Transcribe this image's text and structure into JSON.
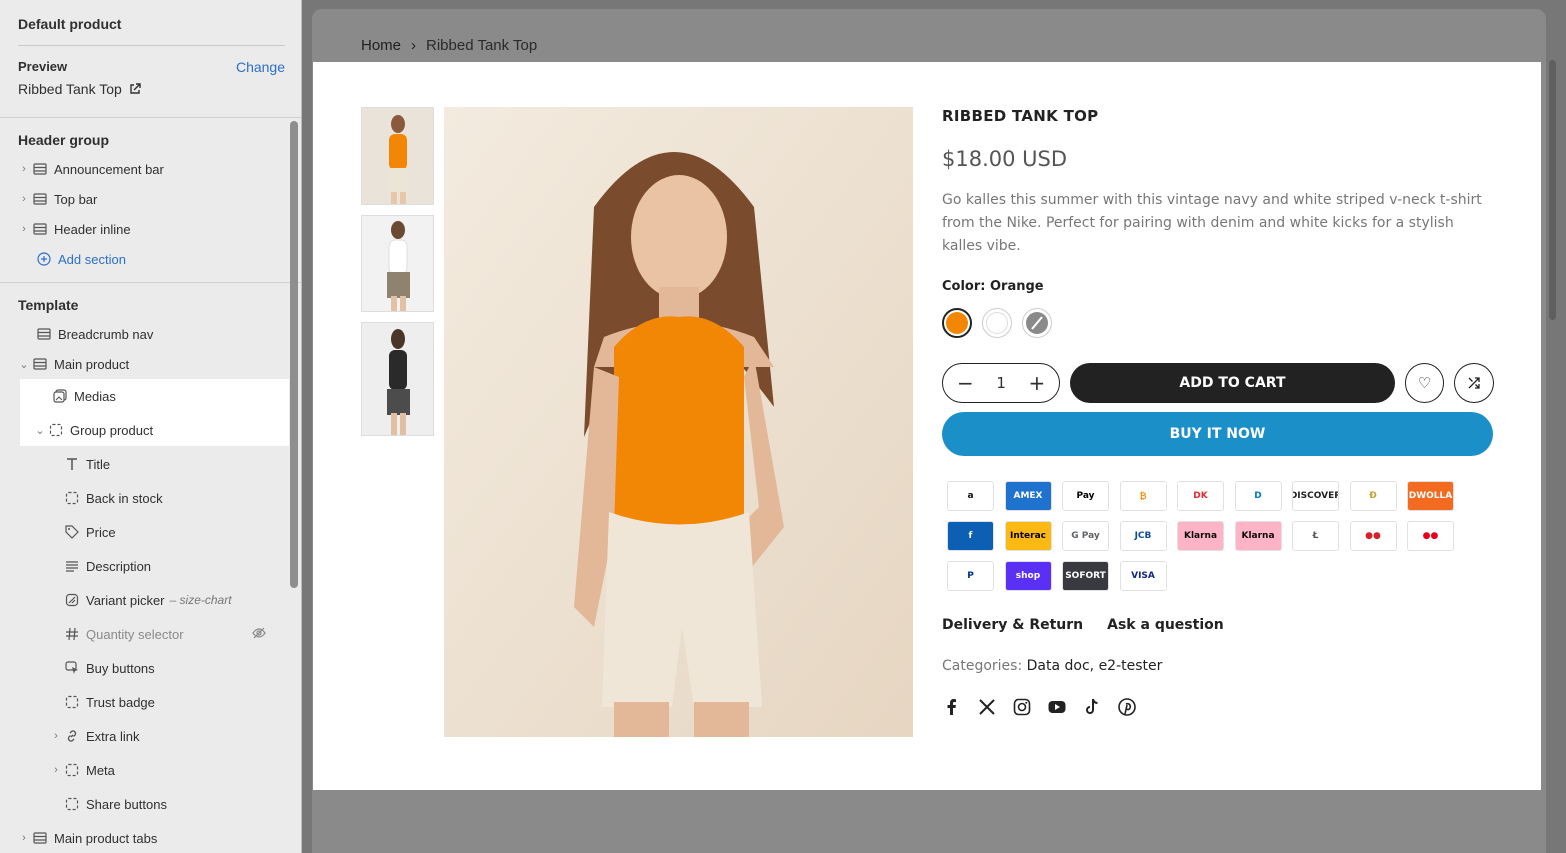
{
  "sidebar": {
    "title": "Default product",
    "preview_label": "Preview",
    "change_label": "Change",
    "preview_product": "Ribbed Tank Top",
    "header_group": {
      "label": "Header group",
      "items": [
        "Announcement bar",
        "Top bar",
        "Header inline"
      ],
      "add_section": "Add section"
    },
    "template": {
      "label": "Template",
      "breadcrumb": "Breadcrumb nav",
      "main_product": "Main product",
      "medias": "Medias",
      "group_product": "Group product",
      "blocks": [
        {
          "label": "Title",
          "icon": "text-icon"
        },
        {
          "label": "Back in stock",
          "icon": "block-icon"
        },
        {
          "label": "Price",
          "icon": "price-tag-icon"
        },
        {
          "label": "Description",
          "icon": "paragraph-icon"
        },
        {
          "label": "Variant picker",
          "hint": "– size-chart",
          "icon": "variant-icon"
        },
        {
          "label": "Quantity selector",
          "icon": "hash-icon",
          "hidden": true
        },
        {
          "label": "Buy buttons",
          "icon": "cursor-icon"
        },
        {
          "label": "Trust badge",
          "icon": "block-icon"
        },
        {
          "label": "Extra link",
          "icon": "link-icon",
          "expandable": true
        },
        {
          "label": "Meta",
          "icon": "block-icon",
          "expandable": true
        },
        {
          "label": "Share buttons",
          "icon": "block-icon"
        }
      ],
      "main_product_tabs": "Main product tabs"
    }
  },
  "breadcrumb": {
    "home": "Home",
    "separator": "›",
    "current": "Ribbed Tank Top"
  },
  "product": {
    "title": "RIBBED TANK TOP",
    "price": "$18.00 USD",
    "description": "Go kalles this summer with this vintage navy and white striped v-neck t-shirt from the Nike. Perfect for pairing with denim and white kicks for a stylish kalles vibe.",
    "color_label": "Color: Orange",
    "swatches": [
      {
        "name": "orange",
        "color": "#f28705",
        "selected": true
      },
      {
        "name": "white",
        "color": "#ffffff",
        "selected": false
      },
      {
        "name": "grey",
        "color": "#8a8a8a",
        "selected": false
      }
    ],
    "quantity": "1",
    "add_to_cart": "ADD TO CART",
    "buy_now": "BUY IT NOW",
    "payments": [
      {
        "label": "a",
        "bg": "#ffffff",
        "fg": "#111111"
      },
      {
        "label": "AMEX",
        "bg": "#1f72cd",
        "fg": "#ffffff"
      },
      {
        "label": " Pay",
        "bg": "#ffffff",
        "fg": "#000000"
      },
      {
        "label": "₿",
        "bg": "#ffffff",
        "fg": "#f7931a"
      },
      {
        "label": "DK",
        "bg": "#ffffff",
        "fg": "#e32b32"
      },
      {
        "label": "D",
        "bg": "#ffffff",
        "fg": "#0079be"
      },
      {
        "label": "DISCOVER",
        "bg": "#ffffff",
        "fg": "#222222"
      },
      {
        "label": "Ð",
        "bg": "#ffffff",
        "fg": "#c2a633"
      },
      {
        "label": "DWOLLA",
        "bg": "#f26b21",
        "fg": "#ffffff"
      },
      {
        "label": "f",
        "bg": "#0c5fb3",
        "fg": "#ffffff"
      },
      {
        "label": "Interac",
        "bg": "#fdb913",
        "fg": "#000000"
      },
      {
        "label": "G Pay",
        "bg": "#ffffff",
        "fg": "#5f6368"
      },
      {
        "label": "JCB",
        "bg": "#ffffff",
        "fg": "#0e4c96"
      },
      {
        "label": "Klarna",
        "bg": "#ffb3c7",
        "fg": "#0a0b09"
      },
      {
        "label": "Klarna",
        "bg": "#ffb3c7",
        "fg": "#0a0b09"
      },
      {
        "label": "Ł",
        "bg": "#ffffff",
        "fg": "#555555"
      },
      {
        "label": "●●",
        "bg": "#ffffff",
        "fg": "#d82028"
      },
      {
        "label": "●●",
        "bg": "#ffffff",
        "fg": "#eb001b"
      },
      {
        "label": "P",
        "bg": "#ffffff",
        "fg": "#003087"
      },
      {
        "label": "shop",
        "bg": "#5a31f4",
        "fg": "#ffffff"
      },
      {
        "label": "SOFORT",
        "bg": "#393a41",
        "fg": "#ffffff"
      },
      {
        "label": "VISA",
        "bg": "#ffffff",
        "fg": "#142688"
      }
    ],
    "delivery_link": "Delivery & Return",
    "question_link": "Ask a question",
    "categories_label": "Categories:",
    "categories": "Data doc, e2-tester",
    "social": [
      "facebook-icon",
      "x-icon",
      "instagram-icon",
      "youtube-icon",
      "tiktok-icon",
      "pinterest-icon"
    ]
  }
}
